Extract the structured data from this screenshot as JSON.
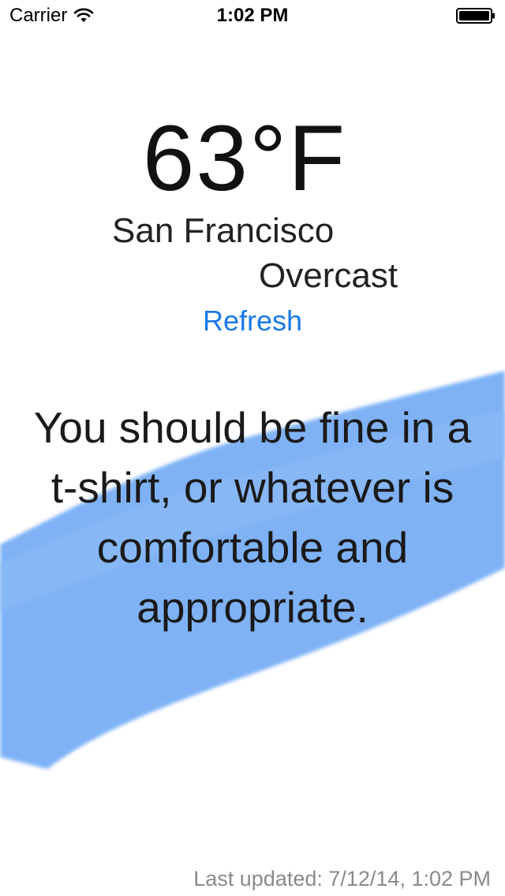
{
  "status_bar": {
    "carrier": "Carrier",
    "time": "1:02 PM",
    "wifi_icon": "wifi-icon",
    "battery_icon": "battery-full-icon"
  },
  "weather": {
    "temperature": "63°F",
    "city": "San Francisco",
    "condition": "Overcast"
  },
  "actions": {
    "refresh_label": "Refresh"
  },
  "advice": {
    "text": "You should be fine in a t-shirt, or whatever is comfortable and appropriate."
  },
  "footer": {
    "last_updated": "Last updated: 7/12/14, 1:02 PM"
  },
  "colors": {
    "accent": "#1a7ae6",
    "brush": "#7fb2f5",
    "background": "#ffffff"
  }
}
